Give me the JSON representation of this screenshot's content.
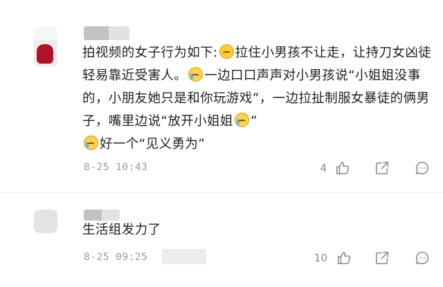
{
  "comments": [
    {
      "text_parts": [
        "拍视频的女子行为如下:",
        "拉住小男孩不让走，让持刀女凶徒轻易靠近受害人。",
        "一边口口声声对小男孩说“小姐姐没事的，小朋友她只是和你玩游戏”，一边拉扯制服女暴徒的俩男子，嘴里边说“放开小姐姐",
        "”",
        "好一个“见义勇为”"
      ],
      "timestamp": "8-25 10:43",
      "likes": "4",
      "emoji_names": [
        "grimace-emoji",
        "crying-emoji",
        "crying-emoji",
        "crying-emoji"
      ]
    },
    {
      "text": "生活组发力了",
      "timestamp": "8-25 09:25",
      "likes": "10"
    }
  ],
  "colors": {
    "text": "#1f1f1f",
    "meta": "#9a9a9a",
    "icon": "#8a8a8a",
    "avatar_accent": "#b11226",
    "emoji": "#ffcc33"
  },
  "icons": {
    "like": "thumbs-up-icon",
    "share": "share-icon",
    "reply": "comment-bubble-icon"
  }
}
